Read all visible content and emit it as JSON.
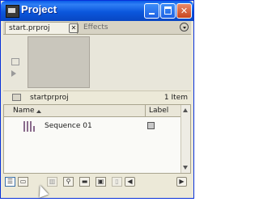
{
  "window": {
    "title": "Project"
  },
  "tabs": [
    {
      "label": "start.prproj",
      "active": true
    },
    {
      "label": "Effects",
      "active": false
    }
  ],
  "project": {
    "name": "startprproj",
    "item_count": "1 Item"
  },
  "list": {
    "columns": {
      "name": "Name",
      "label": "Label"
    },
    "items": [
      {
        "name": "Sequence 01"
      }
    ]
  },
  "toolbar": {
    "items": [
      "list-view-icon",
      "icon-view-icon",
      "automate-icon",
      "find-icon",
      "new-bin-icon",
      "new-item-icon",
      "delete-icon",
      "scroll-left-icon",
      "scroll-right-icon"
    ]
  },
  "colors": {
    "titlebar": "#0a5ce8",
    "panel": "#ece9d8",
    "sequence_icon": "#8a6b8c"
  }
}
